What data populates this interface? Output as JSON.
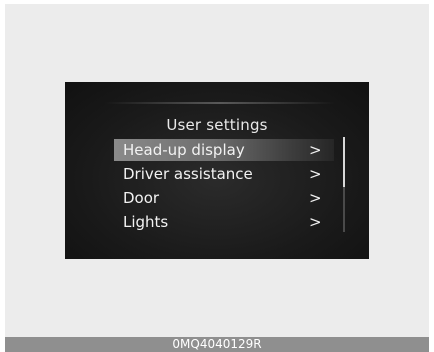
{
  "screen": {
    "title": "User settings",
    "menu_items": [
      {
        "label": "Head-up display",
        "chevron": ">",
        "selected": true
      },
      {
        "label": "Driver assistance",
        "chevron": ">",
        "selected": false
      },
      {
        "label": "Door",
        "chevron": ">",
        "selected": false
      },
      {
        "label": "Lights",
        "chevron": ">",
        "selected": false
      }
    ]
  },
  "figure_code": "0MQ4040129R",
  "colors": {
    "screen_bg": "#1a1a1a",
    "highlight": "#8a8a8a",
    "text": "#f2f2f2",
    "frame_bg": "#ececec",
    "code_bar": "#8f8f8f"
  }
}
